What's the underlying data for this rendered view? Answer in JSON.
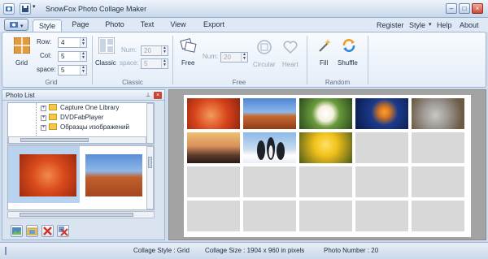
{
  "app": {
    "title": "SnowFox Photo Collage Maker"
  },
  "tabs": [
    "Style",
    "Page",
    "Photo",
    "Text",
    "View",
    "Export"
  ],
  "menu_right": {
    "register": "Register",
    "style": "Style",
    "help": "Help",
    "about": "About"
  },
  "ribbon": {
    "grid": {
      "button": "Grid",
      "row_label": "Row:",
      "row_value": "4",
      "col_label": "Col:",
      "col_value": "5",
      "space_label": "space:",
      "space_value": "5",
      "group_label": "Grid"
    },
    "classic": {
      "button": "Classic",
      "num_label": "Num:",
      "num_value": "20",
      "space_label": "space:",
      "space_value": "5",
      "group_label": "Classic"
    },
    "free": {
      "button": "Free",
      "num_label": "Num:",
      "num_value": "20",
      "circular": "Circular",
      "heart": "Heart",
      "group_label": "Free"
    },
    "random": {
      "fill": "Fill",
      "shuffle": "Shuffle",
      "group_label": "Random"
    }
  },
  "photo_list": {
    "title": "Photo List",
    "tree": [
      "Capture One Library",
      "DVDFabPlayer",
      "Образцы изображений"
    ]
  },
  "status": {
    "collage_style": "Collage Style : Grid",
    "collage_size": "Collage Size : 1904 x 960  in pixels",
    "photo_number": "Photo Number : 20"
  }
}
